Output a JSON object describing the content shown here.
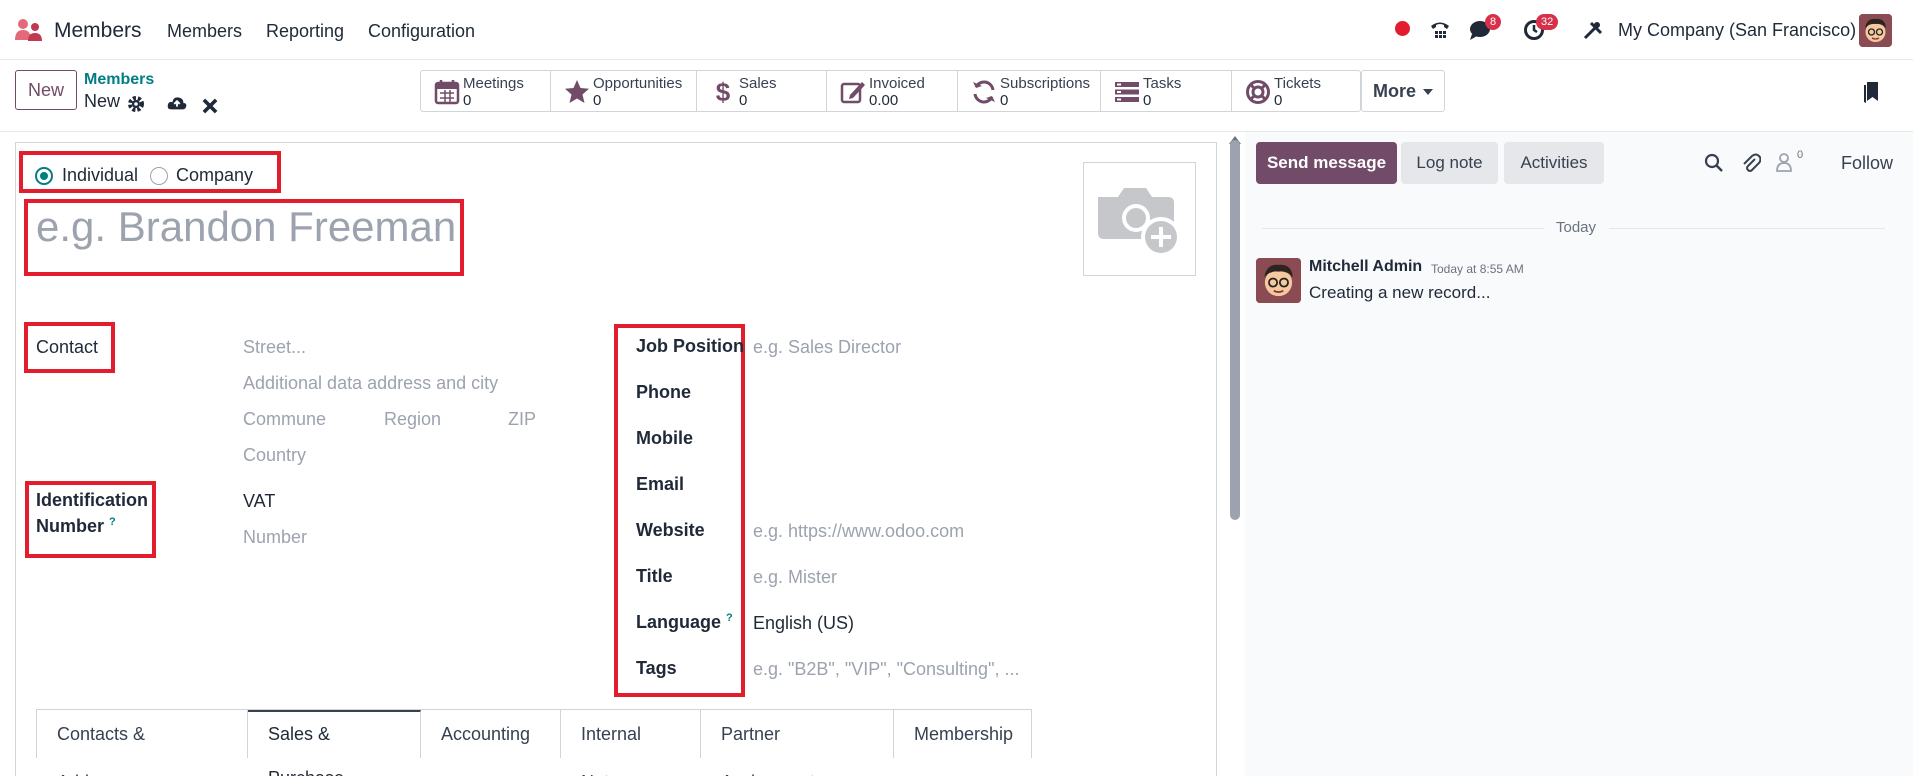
{
  "navbar": {
    "app_name": "Members",
    "menu": [
      "Members",
      "Reporting",
      "Configuration"
    ],
    "messages_count": "8",
    "activities_count": "32",
    "company": "My Company (San Francisco)",
    "brand_color": "#714b67",
    "accent_color": "#017e84"
  },
  "control_panel": {
    "new_button": "New",
    "breadcrumb_parent": "Members",
    "breadcrumb_current": "New",
    "smart_buttons": [
      {
        "label": "Meetings",
        "value": "0",
        "icon": "calendar-icon"
      },
      {
        "label": "Opportunities",
        "value": "0",
        "icon": "star-icon"
      },
      {
        "label": "Sales",
        "value": "0",
        "icon": "dollar-icon"
      },
      {
        "label": "Invoiced",
        "value": "0.00",
        "icon": "edit-icon"
      },
      {
        "label": "Subscriptions",
        "value": "0",
        "icon": "refresh-icon"
      },
      {
        "label": "Tasks",
        "value": "0",
        "icon": "tasks-icon"
      },
      {
        "label": "Tickets",
        "value": "0",
        "icon": "lifebuoy-icon"
      }
    ],
    "more_button": "More"
  },
  "form": {
    "type_options": {
      "individual": "Individual",
      "company": "Company",
      "selected": "Individual"
    },
    "name_placeholder": "e.g. Brandon Freeman",
    "contact_label": "Contact",
    "street_placeholder": "Street...",
    "address_placeholder": "Additional data address and city",
    "commune_placeholder": "Commune",
    "region_placeholder": "Region",
    "zip_placeholder": "ZIP",
    "country_placeholder": "Country",
    "identification_label_1": "Identification",
    "identification_label_2": "Number",
    "vat_value": "VAT",
    "number_placeholder": "Number",
    "right_fields": {
      "job_position": {
        "label": "Job Position",
        "placeholder": "e.g. Sales Director"
      },
      "phone": {
        "label": "Phone"
      },
      "mobile": {
        "label": "Mobile"
      },
      "email": {
        "label": "Email"
      },
      "website": {
        "label": "Website",
        "placeholder": "e.g. https://www.odoo.com"
      },
      "title": {
        "label": "Title",
        "placeholder": "e.g. Mister"
      },
      "language": {
        "label": "Language",
        "value": "English (US)"
      },
      "tags": {
        "label": "Tags",
        "placeholder": "e.g. \"B2B\", \"VIP\", \"Consulting\", ..."
      }
    },
    "tabs": [
      "Contacts & Addresses",
      "Sales & Purchase",
      "Accounting",
      "Internal Notes",
      "Partner Assignment",
      "Membership"
    ],
    "active_tab": "Sales & Purchase"
  },
  "chatter": {
    "send_message": "Send message",
    "log_note": "Log note",
    "activities": "Activities",
    "followers_count": "0",
    "follow": "Follow",
    "date_separator": "Today",
    "message": {
      "author": "Mitchell Admin",
      "time": "Today at 8:55 AM",
      "body": "Creating a new record..."
    }
  }
}
